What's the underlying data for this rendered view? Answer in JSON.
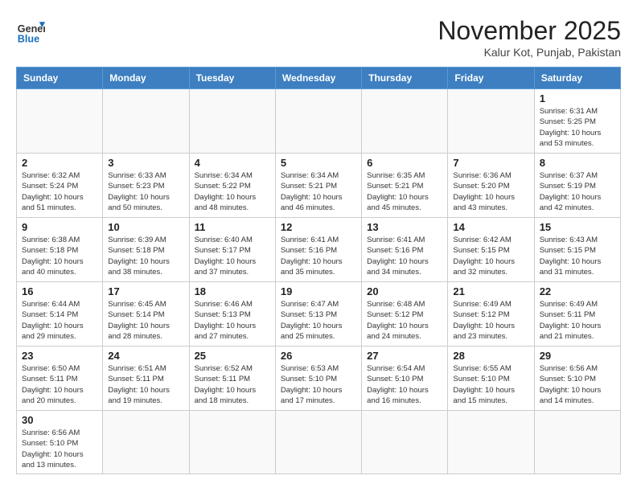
{
  "header": {
    "logo_general": "General",
    "logo_blue": "Blue",
    "month_title": "November 2025",
    "location": "Kalur Kot, Punjab, Pakistan"
  },
  "weekdays": [
    "Sunday",
    "Monday",
    "Tuesday",
    "Wednesday",
    "Thursday",
    "Friday",
    "Saturday"
  ],
  "weeks": [
    [
      {
        "day": "",
        "info": ""
      },
      {
        "day": "",
        "info": ""
      },
      {
        "day": "",
        "info": ""
      },
      {
        "day": "",
        "info": ""
      },
      {
        "day": "",
        "info": ""
      },
      {
        "day": "",
        "info": ""
      },
      {
        "day": "1",
        "info": "Sunrise: 6:31 AM\nSunset: 5:25 PM\nDaylight: 10 hours and 53 minutes."
      }
    ],
    [
      {
        "day": "2",
        "info": "Sunrise: 6:32 AM\nSunset: 5:24 PM\nDaylight: 10 hours and 51 minutes."
      },
      {
        "day": "3",
        "info": "Sunrise: 6:33 AM\nSunset: 5:23 PM\nDaylight: 10 hours and 50 minutes."
      },
      {
        "day": "4",
        "info": "Sunrise: 6:34 AM\nSunset: 5:22 PM\nDaylight: 10 hours and 48 minutes."
      },
      {
        "day": "5",
        "info": "Sunrise: 6:34 AM\nSunset: 5:21 PM\nDaylight: 10 hours and 46 minutes."
      },
      {
        "day": "6",
        "info": "Sunrise: 6:35 AM\nSunset: 5:21 PM\nDaylight: 10 hours and 45 minutes."
      },
      {
        "day": "7",
        "info": "Sunrise: 6:36 AM\nSunset: 5:20 PM\nDaylight: 10 hours and 43 minutes."
      },
      {
        "day": "8",
        "info": "Sunrise: 6:37 AM\nSunset: 5:19 PM\nDaylight: 10 hours and 42 minutes."
      }
    ],
    [
      {
        "day": "9",
        "info": "Sunrise: 6:38 AM\nSunset: 5:18 PM\nDaylight: 10 hours and 40 minutes."
      },
      {
        "day": "10",
        "info": "Sunrise: 6:39 AM\nSunset: 5:18 PM\nDaylight: 10 hours and 38 minutes."
      },
      {
        "day": "11",
        "info": "Sunrise: 6:40 AM\nSunset: 5:17 PM\nDaylight: 10 hours and 37 minutes."
      },
      {
        "day": "12",
        "info": "Sunrise: 6:41 AM\nSunset: 5:16 PM\nDaylight: 10 hours and 35 minutes."
      },
      {
        "day": "13",
        "info": "Sunrise: 6:41 AM\nSunset: 5:16 PM\nDaylight: 10 hours and 34 minutes."
      },
      {
        "day": "14",
        "info": "Sunrise: 6:42 AM\nSunset: 5:15 PM\nDaylight: 10 hours and 32 minutes."
      },
      {
        "day": "15",
        "info": "Sunrise: 6:43 AM\nSunset: 5:15 PM\nDaylight: 10 hours and 31 minutes."
      }
    ],
    [
      {
        "day": "16",
        "info": "Sunrise: 6:44 AM\nSunset: 5:14 PM\nDaylight: 10 hours and 29 minutes."
      },
      {
        "day": "17",
        "info": "Sunrise: 6:45 AM\nSunset: 5:14 PM\nDaylight: 10 hours and 28 minutes."
      },
      {
        "day": "18",
        "info": "Sunrise: 6:46 AM\nSunset: 5:13 PM\nDaylight: 10 hours and 27 minutes."
      },
      {
        "day": "19",
        "info": "Sunrise: 6:47 AM\nSunset: 5:13 PM\nDaylight: 10 hours and 25 minutes."
      },
      {
        "day": "20",
        "info": "Sunrise: 6:48 AM\nSunset: 5:12 PM\nDaylight: 10 hours and 24 minutes."
      },
      {
        "day": "21",
        "info": "Sunrise: 6:49 AM\nSunset: 5:12 PM\nDaylight: 10 hours and 23 minutes."
      },
      {
        "day": "22",
        "info": "Sunrise: 6:49 AM\nSunset: 5:11 PM\nDaylight: 10 hours and 21 minutes."
      }
    ],
    [
      {
        "day": "23",
        "info": "Sunrise: 6:50 AM\nSunset: 5:11 PM\nDaylight: 10 hours and 20 minutes."
      },
      {
        "day": "24",
        "info": "Sunrise: 6:51 AM\nSunset: 5:11 PM\nDaylight: 10 hours and 19 minutes."
      },
      {
        "day": "25",
        "info": "Sunrise: 6:52 AM\nSunset: 5:11 PM\nDaylight: 10 hours and 18 minutes."
      },
      {
        "day": "26",
        "info": "Sunrise: 6:53 AM\nSunset: 5:10 PM\nDaylight: 10 hours and 17 minutes."
      },
      {
        "day": "27",
        "info": "Sunrise: 6:54 AM\nSunset: 5:10 PM\nDaylight: 10 hours and 16 minutes."
      },
      {
        "day": "28",
        "info": "Sunrise: 6:55 AM\nSunset: 5:10 PM\nDaylight: 10 hours and 15 minutes."
      },
      {
        "day": "29",
        "info": "Sunrise: 6:56 AM\nSunset: 5:10 PM\nDaylight: 10 hours and 14 minutes."
      }
    ],
    [
      {
        "day": "30",
        "info": "Sunrise: 6:56 AM\nSunset: 5:10 PM\nDaylight: 10 hours and 13 minutes."
      },
      {
        "day": "",
        "info": ""
      },
      {
        "day": "",
        "info": ""
      },
      {
        "day": "",
        "info": ""
      },
      {
        "day": "",
        "info": ""
      },
      {
        "day": "",
        "info": ""
      },
      {
        "day": "",
        "info": ""
      }
    ]
  ]
}
